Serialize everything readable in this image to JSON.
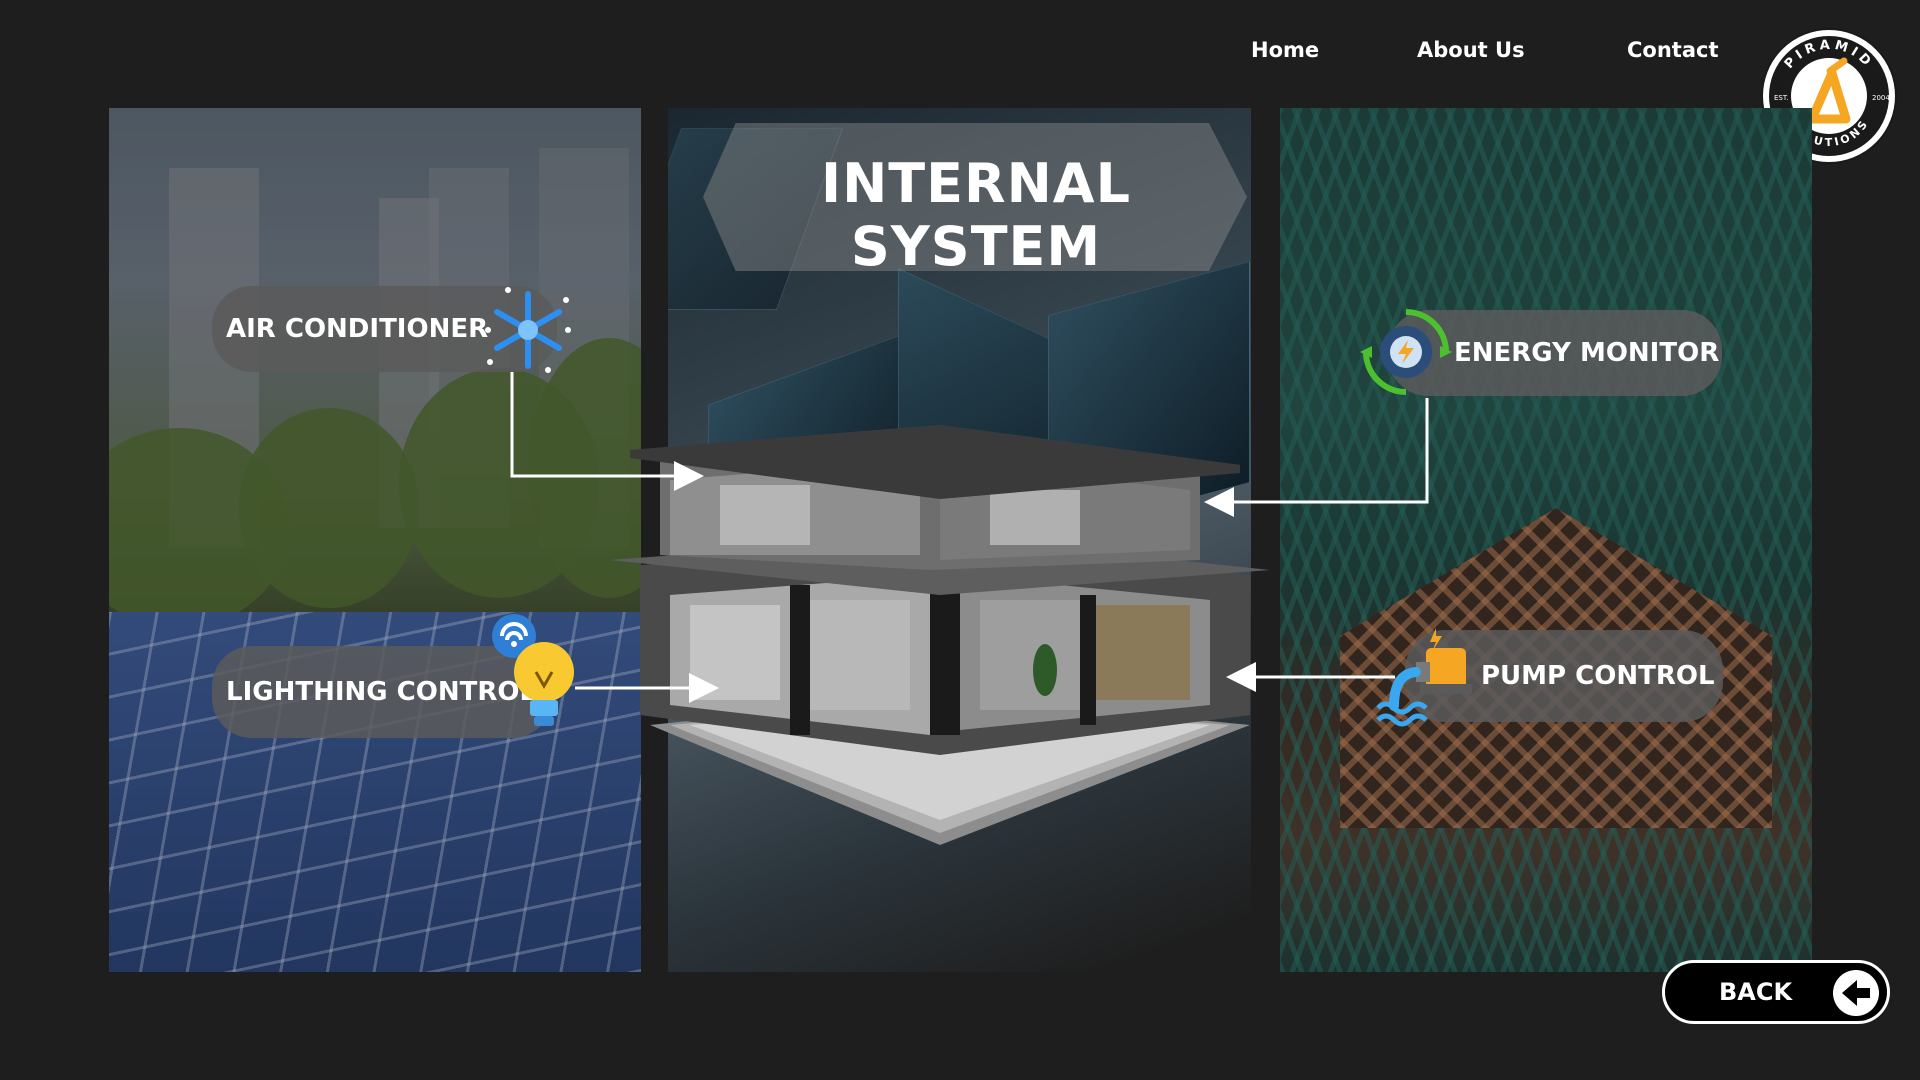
{
  "nav": {
    "home": "Home",
    "about": "About Us",
    "contact": "Contact"
  },
  "logo": {
    "top_text": "PIRAMID",
    "bottom_text": "SOLUTIONS",
    "left_text": "EST.",
    "right_text": "2004"
  },
  "title": "INTERNAL SYSTEM",
  "labels": {
    "air_conditioner": "AIR CONDITIONER",
    "lighting_control": "LIGHTHING CONTROL",
    "energy_monitor": "ENERGY MONITOR",
    "pump_control": "PUMP CONTROL"
  },
  "icons": {
    "air_conditioner": "snowflake-icon",
    "lighting_control": "smart-bulb-icon",
    "energy_monitor": "energy-gear-icon",
    "pump_control": "water-pump-icon",
    "back": "arrow-left-icon"
  },
  "back_button": {
    "label": "BACK"
  },
  "colors": {
    "background": "#1e1e1e",
    "accent_orange": "#f5a623",
    "pill": "#5a5a5a",
    "snowflake": "#2d8ff0",
    "bulb": "#f9c932",
    "energy_green": "#4cc02e"
  }
}
